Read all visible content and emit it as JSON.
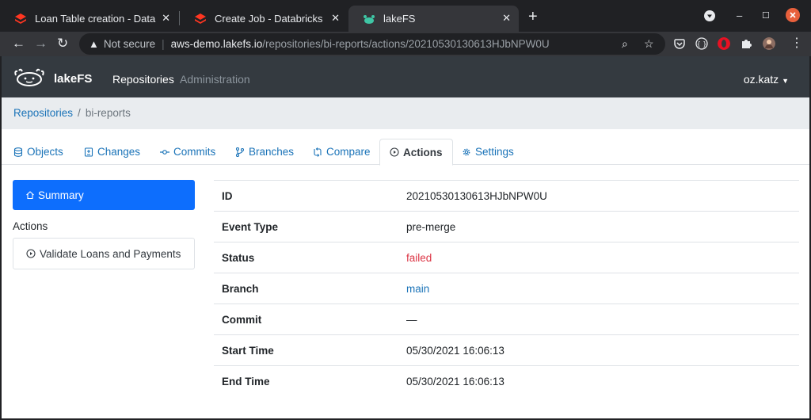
{
  "browser": {
    "tabs": [
      {
        "title": "Loan Table creation - Data",
        "active": false
      },
      {
        "title": "Create Job - Databricks",
        "active": false
      },
      {
        "title": "lakeFS",
        "active": true
      }
    ],
    "address": {
      "security": "Not secure",
      "host": "aws-demo.lakefs.io",
      "path": "/repositories/bi-reports/actions/20210530130613HJbNPW0U"
    }
  },
  "app": {
    "brand": "lakeFS",
    "nav": {
      "repositories": "Repositories",
      "administration": "Administration"
    },
    "user": "oz.katz"
  },
  "breadcrumb": {
    "root": "Repositories",
    "repo": "bi-reports"
  },
  "repo_tabs": [
    {
      "label": "Objects",
      "icon": "database-icon"
    },
    {
      "label": "Changes",
      "icon": "diff-icon"
    },
    {
      "label": "Commits",
      "icon": "commit-icon"
    },
    {
      "label": "Branches",
      "icon": "branch-icon"
    },
    {
      "label": "Compare",
      "icon": "compare-icon"
    },
    {
      "label": "Actions",
      "icon": "play-icon",
      "active": true
    },
    {
      "label": "Settings",
      "icon": "gear-icon"
    }
  ],
  "sidebar": {
    "summary": "Summary",
    "actions_heading": "Actions",
    "action_items": [
      "Validate Loans and Payments"
    ]
  },
  "details": [
    {
      "key": "ID",
      "value": "20210530130613HJbNPW0U"
    },
    {
      "key": "Event Type",
      "value": "pre-merge"
    },
    {
      "key": "Status",
      "value": "failed",
      "status_color": "#dc3545"
    },
    {
      "key": "Branch",
      "value": "main"
    },
    {
      "key": "Commit",
      "value": "—"
    },
    {
      "key": "Start Time",
      "value": "05/30/2021 16:06:13"
    },
    {
      "key": "End Time",
      "value": "05/30/2021 16:06:13"
    }
  ],
  "colors": {
    "accent": "#0d6efd",
    "link": "#1a73b8",
    "navbar": "#343a40",
    "failed": "#dc3545",
    "lakefs_green": "#3fc6a5"
  }
}
